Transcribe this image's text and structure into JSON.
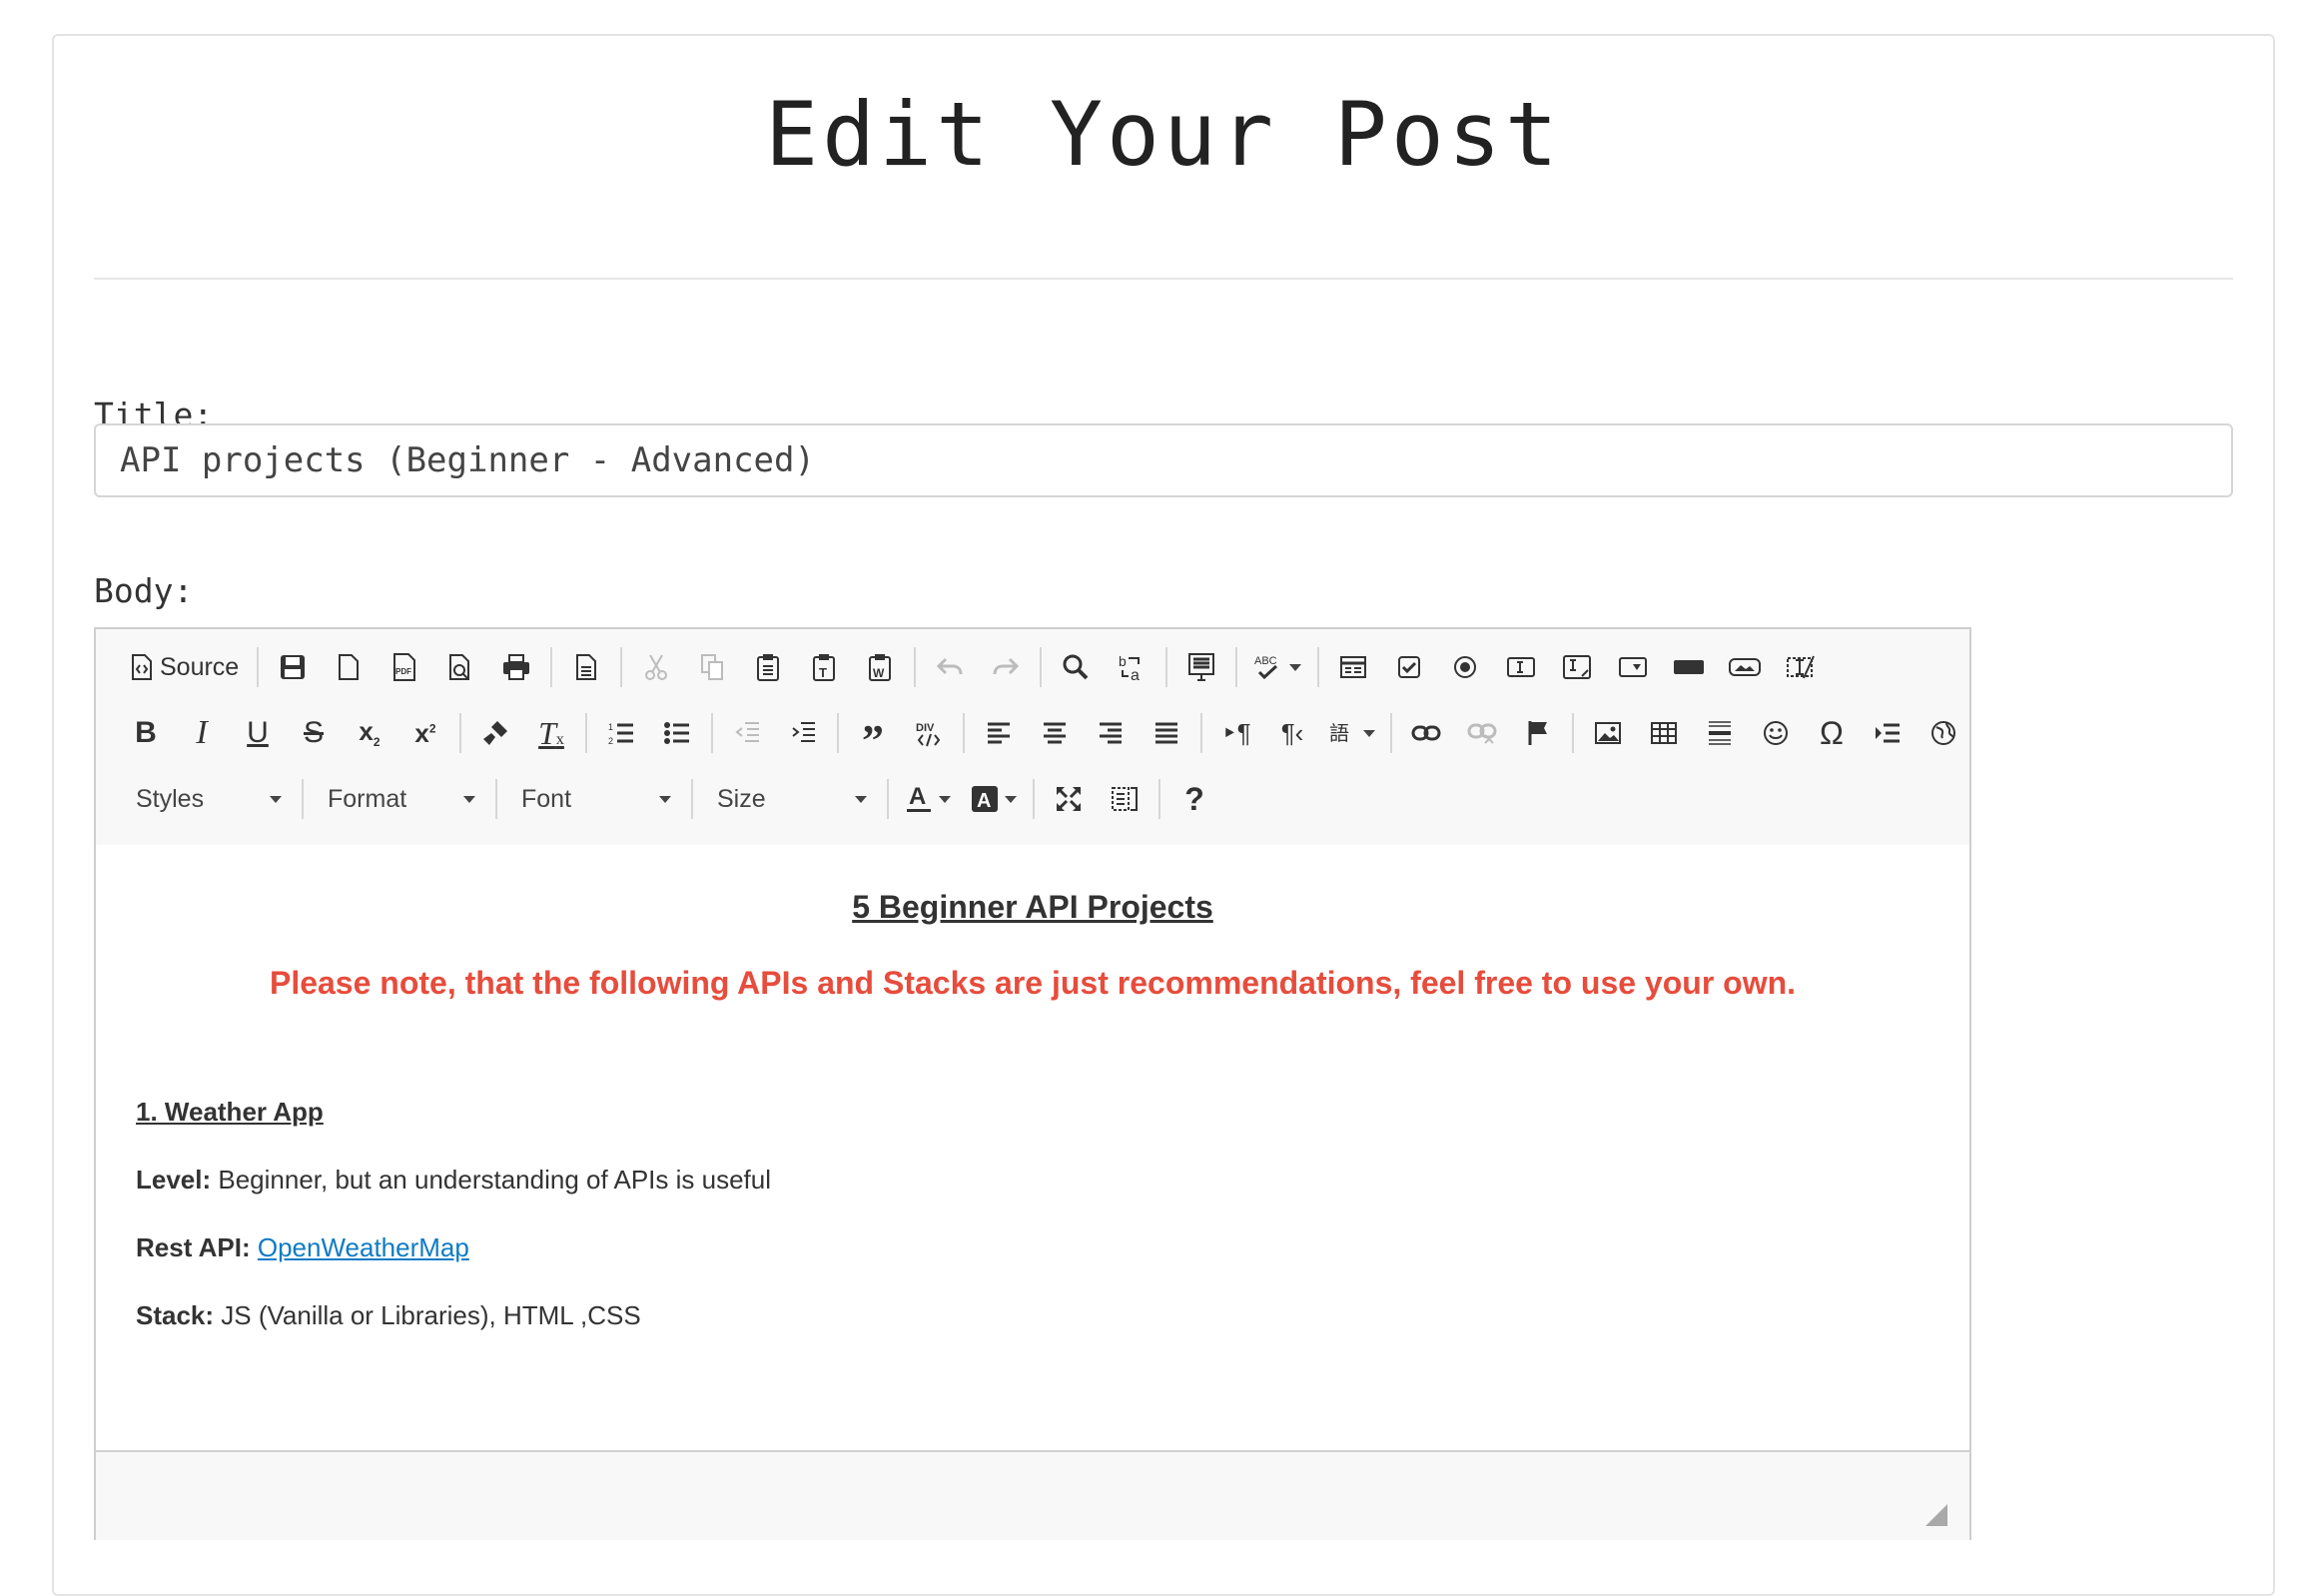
{
  "page": {
    "title": "Edit Your Post"
  },
  "form": {
    "title_label": "Title:",
    "title_value": "API projects (Beginner - Advanced)",
    "body_label": "Body:"
  },
  "toolbar": {
    "source_label": "Source",
    "combos": {
      "styles": "Styles",
      "format": "Format",
      "font": "Font",
      "size": "Size"
    },
    "help_label": "?"
  },
  "content": {
    "heading": "5 Beginner API Projects",
    "note": "Please note, that the following APIs and Stacks are just recommendations, feel free to use your own.",
    "project_title": "1. Weather App ",
    "level_label": "Level:",
    "level_value": " Beginner, but an understanding of APIs is useful",
    "api_label": "Rest API:",
    "api_link": "OpenWeatherMap",
    "stack_label": "Stack:",
    "stack_value": " JS (Vanilla or Libraries), HTML ,CSS"
  },
  "colors": {
    "note_red": "#e74c3c",
    "link_blue": "#0f7bc5"
  }
}
